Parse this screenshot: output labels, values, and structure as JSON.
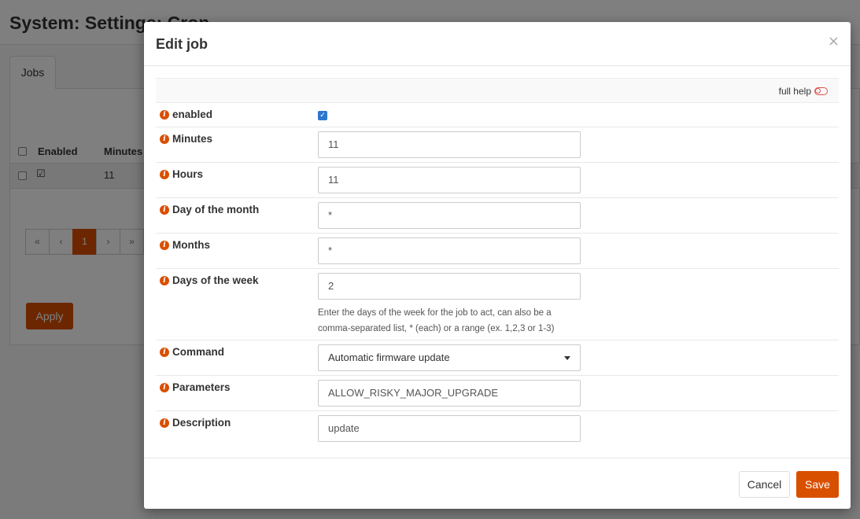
{
  "page": {
    "title": "System: Settings: Cron",
    "tab_jobs": "Jobs",
    "grid": {
      "headers": [
        "Enabled",
        "Minutes"
      ],
      "row": {
        "enabled": "☑",
        "minutes": "11"
      }
    },
    "pager": [
      "«",
      "‹",
      "1",
      "›",
      "»"
    ],
    "apply_label": "Apply"
  },
  "modal": {
    "title": "Edit job",
    "close_glyph": "×",
    "full_help_label": "full help",
    "fields": {
      "enabled": {
        "label": "enabled",
        "checked": true
      },
      "minutes": {
        "label": "Minutes",
        "value": "11"
      },
      "hours": {
        "label": "Hours",
        "value": "11"
      },
      "day_of_month": {
        "label": "Day of the month",
        "value": "*"
      },
      "months": {
        "label": "Months",
        "value": "*"
      },
      "days_of_week": {
        "label": "Days of the week",
        "value": "2",
        "hint": "Enter the days of the week for the job to act, can also be a comma-separated list, * (each) or a range (ex. 1,2,3 or 1-3)"
      },
      "command": {
        "label": "Command",
        "value": "Automatic firmware update"
      },
      "parameters": {
        "label": "Parameters",
        "value": "ALLOW_RISKY_MAJOR_UPGRADE"
      },
      "description": {
        "label": "Description",
        "value": "update"
      }
    },
    "footer": {
      "cancel_label": "Cancel",
      "save_label": "Save"
    }
  },
  "colors": {
    "accent": "#d94f00",
    "checkbox": "#2e77d0"
  }
}
